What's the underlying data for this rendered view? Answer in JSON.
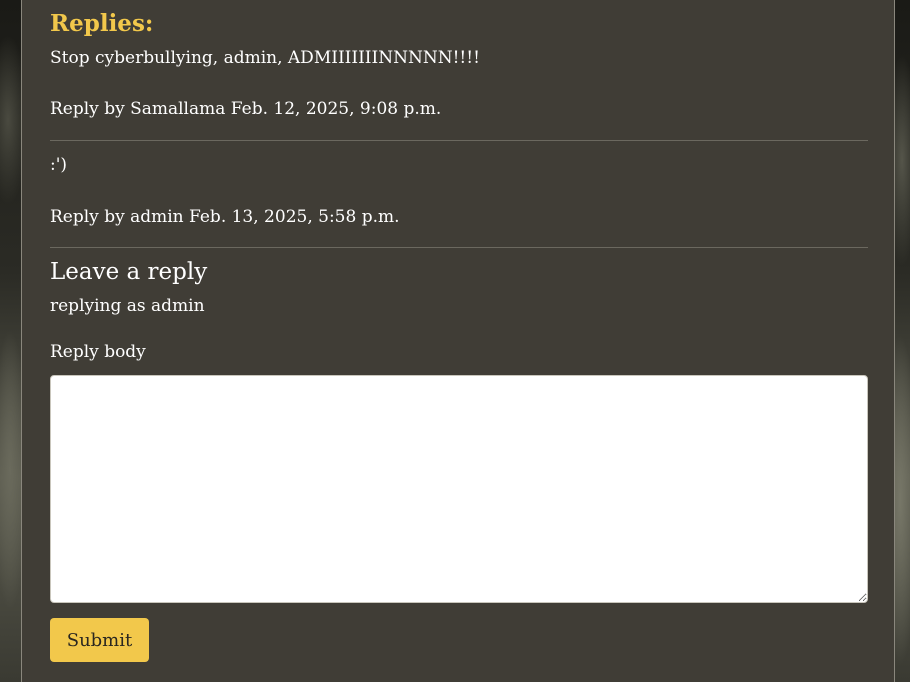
{
  "replies": {
    "heading": "Replies:",
    "items": [
      {
        "body": "Stop cyberbullying, admin, ADMIIIIIIINNNNN!!!!",
        "meta": "Reply by Samallama Feb. 12, 2025, 9:08 p.m."
      },
      {
        "body": ":')",
        "meta": "Reply by admin Feb. 13, 2025, 5:58 p.m."
      }
    ]
  },
  "reply_form": {
    "heading": "Leave a reply",
    "replying_as": "replying as admin",
    "body_label": "Reply body",
    "body_value": "",
    "submit_label": "Submit"
  },
  "colors": {
    "accent": "#f2c84b",
    "panel": "#403d36",
    "text": "#ffffff"
  }
}
